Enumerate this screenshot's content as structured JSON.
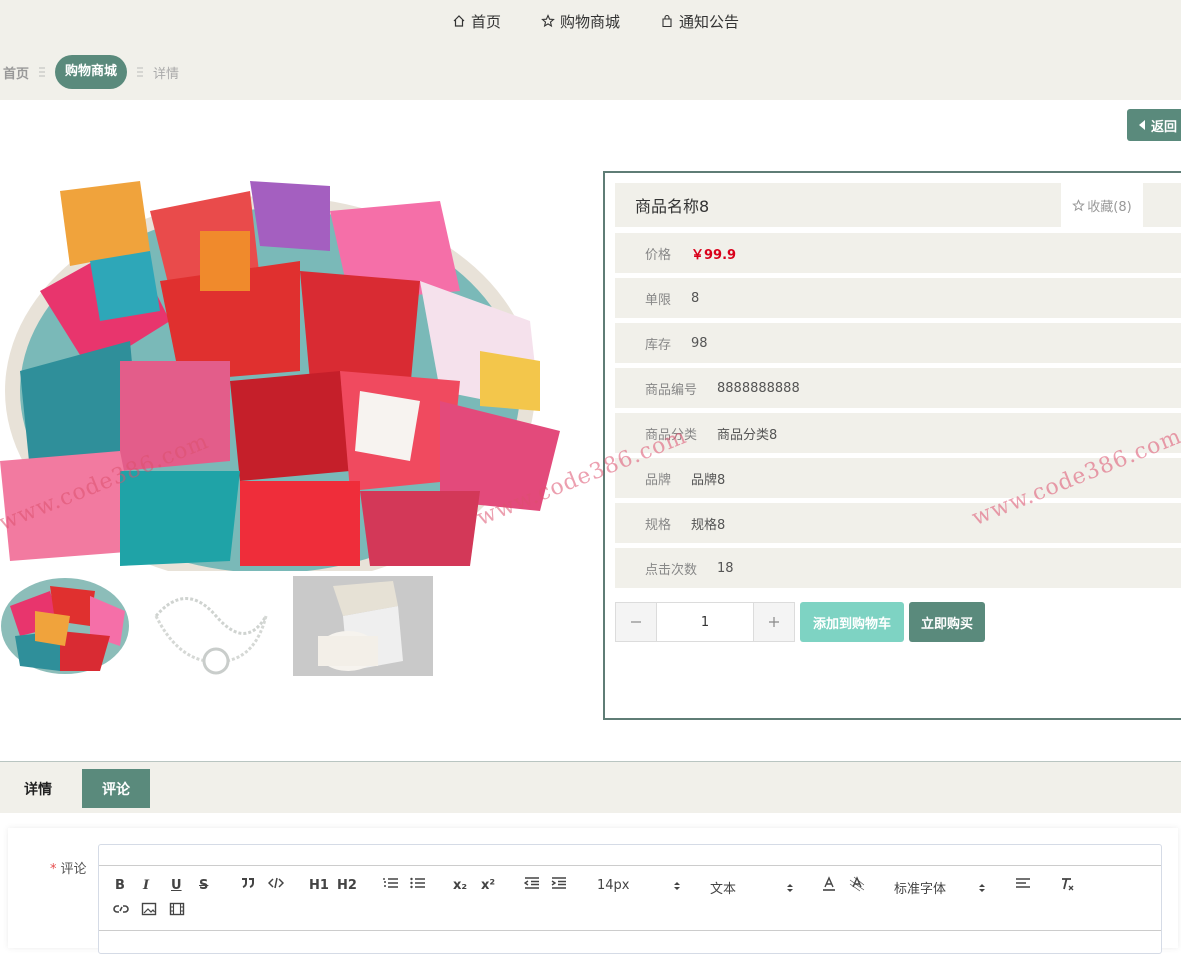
{
  "nav": {
    "items": [
      {
        "label": "首页",
        "icon": "home-icon"
      },
      {
        "label": "购物商城",
        "icon": "star-icon"
      },
      {
        "label": "通知公告",
        "icon": "bag-icon"
      }
    ]
  },
  "breadcrumb": {
    "home": "首页",
    "current": "购物商城",
    "detail": "详情"
  },
  "back_label": "返回",
  "product": {
    "name": "商品名称8",
    "fav_label": "收藏(8)",
    "attrs": [
      {
        "label": "价格",
        "value": "￥99.9"
      },
      {
        "label": "单限",
        "value": "8"
      },
      {
        "label": "库存",
        "value": "98"
      },
      {
        "label": "商品编号",
        "value": "8888888888"
      },
      {
        "label": "商品分类",
        "value": "商品分类8"
      },
      {
        "label": "品牌",
        "value": "品牌8"
      },
      {
        "label": "规格",
        "value": "规格8"
      },
      {
        "label": "点击次数",
        "value": "18"
      }
    ],
    "quantity": "1",
    "add_to_cart": "添加到购物车",
    "buy_now": "立即购买"
  },
  "tabs": {
    "detail": "详情",
    "comment": "评论"
  },
  "comment": {
    "label": "评论",
    "required_mark": "*"
  },
  "editor": {
    "size_select": "14px",
    "header_select": "文本",
    "font_select": "标准字体",
    "buttons": {
      "bold": "B",
      "italic": "I",
      "underline": "U",
      "strike": "S",
      "h1": "H1",
      "h2": "H2",
      "sub": "x₂",
      "sup": "x²"
    }
  },
  "watermark": "www.code386.com",
  "colors": {
    "accent": "#5a8a7c",
    "accent_light": "#7ed3c3",
    "price": "#d9001b",
    "bar_bg": "#f1f0ea"
  }
}
